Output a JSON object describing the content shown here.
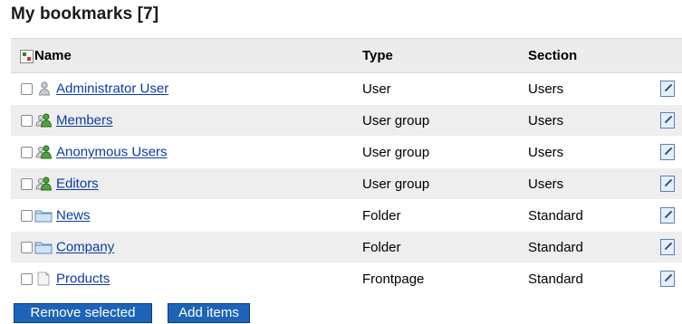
{
  "page": {
    "title": "My bookmarks [7]"
  },
  "table": {
    "columns": [
      "Name",
      "Type",
      "Section"
    ],
    "rows": [
      {
        "name": "Administrator User",
        "type": "User",
        "section": "Users",
        "icon": "user-icon"
      },
      {
        "name": "Members",
        "type": "User group",
        "section": "Users",
        "icon": "user-group-icon"
      },
      {
        "name": "Anonymous Users",
        "type": "User group",
        "section": "Users",
        "icon": "user-group-icon"
      },
      {
        "name": "Editors",
        "type": "User group",
        "section": "Users",
        "icon": "user-group-icon"
      },
      {
        "name": "News",
        "type": "Folder",
        "section": "Standard",
        "icon": "folder-icon"
      },
      {
        "name": "Company",
        "type": "Folder",
        "section": "Standard",
        "icon": "folder-icon"
      },
      {
        "name": "Products",
        "type": "Frontpage",
        "section": "Standard",
        "icon": "page-icon"
      }
    ]
  },
  "buttons": {
    "remove": "Remove selected",
    "add": "Add items"
  },
  "colors": {
    "link": "#0b3aa8",
    "button": "#1d64b8",
    "stripe": "#eeeeee",
    "header": "#ececec"
  }
}
